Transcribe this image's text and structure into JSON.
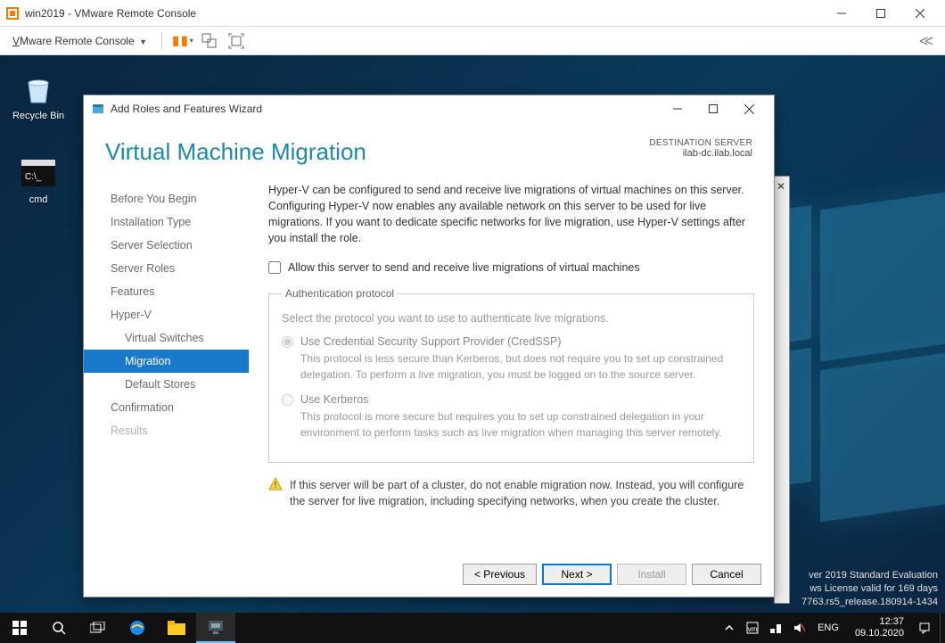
{
  "vmware": {
    "title": "win2019 - VMware Remote Console",
    "menu": "VMware Remote Console"
  },
  "desktop_icons": {
    "recycle": "Recycle Bin",
    "cmd": "cmd"
  },
  "dialog": {
    "window_title": "Add Roles and Features Wizard",
    "heading": "Virtual Machine Migration",
    "dest_label": "DESTINATION SERVER",
    "dest_value": "ilab-dc.ilab.local",
    "nav": {
      "begin": "Before You Begin",
      "install_type": "Installation Type",
      "server_sel": "Server Selection",
      "server_roles": "Server Roles",
      "features": "Features",
      "hyperv": "Hyper-V",
      "vswitch": "Virtual Switches",
      "migration": "Migration",
      "stores": "Default Stores",
      "confirm": "Confirmation",
      "results": "Results"
    },
    "intro": "Hyper-V can be configured to send and receive live migrations of virtual machines on this server. Configuring Hyper-V now enables any available network on this server to be used for live migrations. If you want to dedicate specific networks for live migration, use Hyper-V settings after you install the role.",
    "checkbox_label": "Allow this server to send and receive live migrations of virtual machines",
    "auth": {
      "legend": "Authentication protocol",
      "hint": "Select the protocol you want to use to authenticate live migrations.",
      "credssp_label": "Use Credential Security Support Provider (CredSSP)",
      "credssp_desc": "This protocol is less secure than Kerberos, but does not require you to set up constrained delegation. To perform a live migration, you must be logged on to the source server.",
      "kerb_label": "Use Kerberos",
      "kerb_desc": "This protocol is more secure but requires you to set up constrained delegation in your environment to perform tasks such as live migration when managing this server remotely."
    },
    "warning": "If this server will be part of a cluster, do not enable migration now. Instead, you will configure the server for live migration, including specifying networks, when you create the cluster.",
    "buttons": {
      "prev": "< Previous",
      "next": "Next >",
      "install": "Install",
      "cancel": "Cancel"
    }
  },
  "build": {
    "l1": "ver 2019 Standard Evaluation",
    "l2": "ws License valid for 169 days",
    "l3": "7763.rs5_release.180914-1434"
  },
  "tray": {
    "lang": "ENG",
    "time": "12:37",
    "date": "09.10.2020"
  }
}
